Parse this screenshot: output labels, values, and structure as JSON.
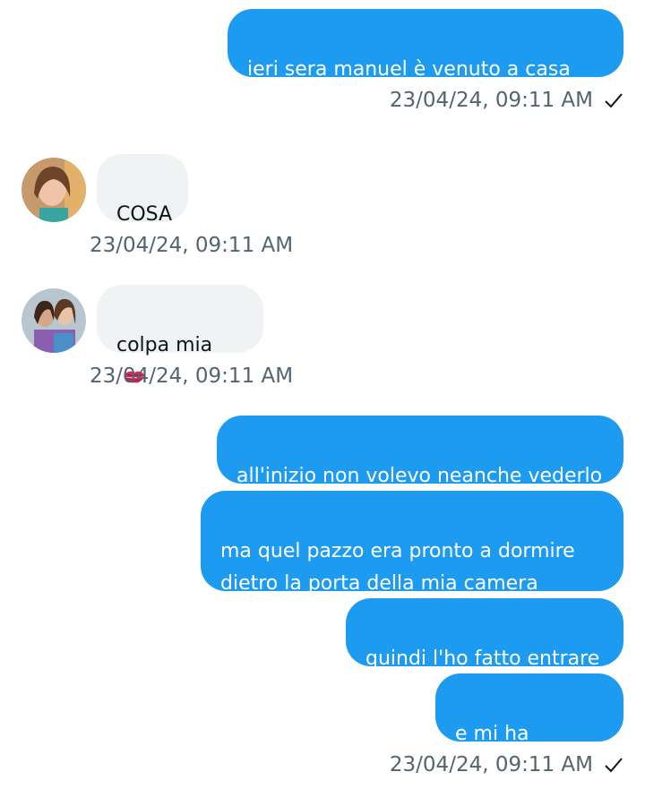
{
  "messages": [
    {
      "text": "ieri sera manuel è venuto a casa mia"
    },
    {
      "text": "COSA"
    },
    {
      "text": "colpa mia"
    },
    {
      "text": "all'inizio non volevo neanche vederlo"
    },
    {
      "text": "ma quel pazzo era pronto a dormire\ndietro la porta della mia camera"
    },
    {
      "text": "quindi l'ho fatto entrare"
    },
    {
      "text": "e mi ha baciato"
    }
  ],
  "timestamps": {
    "t1": "23/04/24, 09:11 AM",
    "t2": "23/04/24, 09:11 AM",
    "t3": "23/04/24, 09:11 AM",
    "t4": "23/04/24, 09:11 AM"
  },
  "icons": {
    "read_receipt": "checkmark-icon",
    "kiss": "kiss-mark-emoji-icon"
  },
  "colors": {
    "outgoing_bubble": "#1d9bf0",
    "incoming_bubble": "#eff3f4",
    "timestamp": "#536471"
  }
}
